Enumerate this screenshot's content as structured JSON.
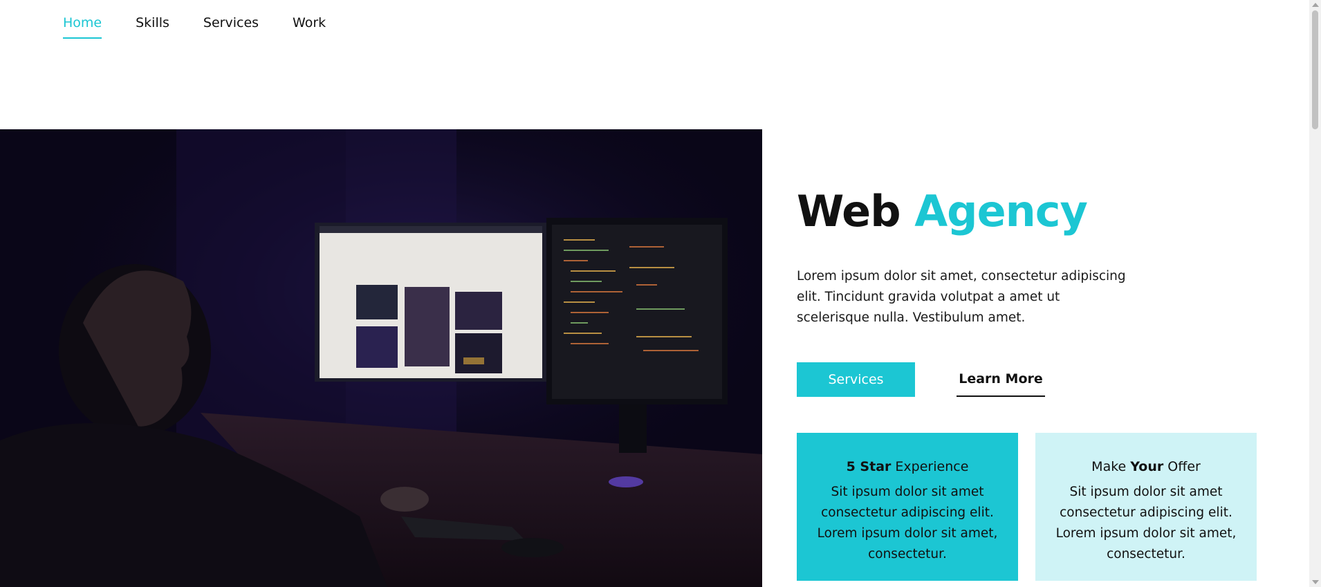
{
  "nav": {
    "items": [
      {
        "label": "Home",
        "active": true
      },
      {
        "label": "Skills",
        "active": false
      },
      {
        "label": "Services",
        "active": false
      },
      {
        "label": "Work",
        "active": false
      }
    ]
  },
  "hero": {
    "title_part1": "Web",
    "title_part2": "Agency",
    "description": "Lorem ipsum dolor sit amet, consectetur adipiscing elit. Tincidunt gravida volutpat a amet ut scelerisque nulla. Vestibulum amet.",
    "primary_button": "Services",
    "secondary_button": "Learn More"
  },
  "cards": [
    {
      "title_bold": "5 Star",
      "title_rest": " Experience",
      "text": "Sit ipsum dolor sit amet consectetur adipiscing elit. Lorem ipsum dolor sit amet, consectetur."
    },
    {
      "title_pre": "Make ",
      "title_bold": "Your",
      "title_rest": " Offer",
      "text": "Sit ipsum dolor sit amet consectetur adipiscing elit. Lorem ipsum dolor sit amet, consectetur."
    }
  ],
  "colors": {
    "accent": "#1cc6d3",
    "accent_light": "#cff3f6",
    "text": "#111111"
  },
  "icons": {
    "hero_image": "developer-at-desk-photo"
  }
}
